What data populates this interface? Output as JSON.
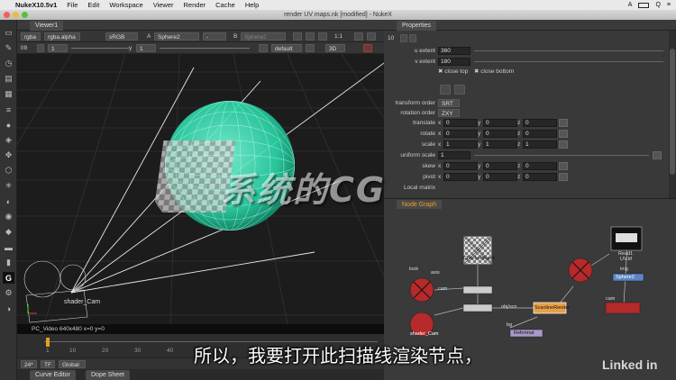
{
  "menubar": {
    "app": "NukeX10.5v1",
    "items": [
      "File",
      "Edit",
      "Workspace",
      "Viewer",
      "Render",
      "Cache",
      "Help"
    ],
    "right": [
      "A",
      "Q"
    ]
  },
  "window_title": "render UV maps.nk [modified] - NukeX",
  "viewer": {
    "tab": "Viewer1",
    "bar1": {
      "channels": "rgba",
      "alpha": "rgba.alpha",
      "colorspace": "sRGB",
      "a_label": "A",
      "a_input": "Sphere2",
      "dash": "-",
      "b_label": "B",
      "b_input": "Sphere2",
      "zoom": "1:1"
    },
    "bar2": {
      "fstop": "f/8",
      "gain": "1",
      "y_label": "y",
      "gamma": "1",
      "camera": "default",
      "mode": "3D"
    },
    "camera_label": "shader_Cam",
    "status": "PC_Video 640x480  x=0 y=0"
  },
  "timebar": {
    "fps": "24*",
    "tf": "TF",
    "global": "Global",
    "ticks": [
      "1",
      "10",
      "20",
      "30",
      "40"
    ]
  },
  "bottom_tabs": [
    "Curve Editor",
    "Dope Sheet"
  ],
  "properties": {
    "title": "Properties",
    "count": "10",
    "rows": [
      {
        "name": "u extent",
        "values": [
          "360"
        ]
      },
      {
        "name": "v extent",
        "values": [
          "180"
        ]
      },
      {
        "name": "transform order",
        "values": [
          "SRT"
        ]
      },
      {
        "name": "rotation order",
        "values": [
          "ZXY"
        ]
      },
      {
        "name": "translate",
        "values": [
          "0",
          "0",
          "0"
        ]
      },
      {
        "name": "rotate",
        "values": [
          "0",
          "0",
          "0"
        ]
      },
      {
        "name": "scale",
        "values": [
          "1",
          "1",
          "1"
        ]
      },
      {
        "name": "uniform scale",
        "values": [
          "1"
        ]
      },
      {
        "name": "skew",
        "values": [
          "0",
          "0",
          "0"
        ]
      },
      {
        "name": "pivot",
        "values": [
          "0",
          "0",
          "0"
        ]
      },
      {
        "name": "Local matrix",
        "values": []
      }
    ],
    "close_top": "close top",
    "close_bottom": "close bottom",
    "axes": [
      "x",
      "y",
      "z"
    ]
  },
  "nodegraph": {
    "title": "Node Graph",
    "nodes": {
      "checkerboard": "Checkerboard",
      "read": "Read1",
      "read_sub": "UV.tif",
      "sphere": "Sphere2",
      "scanline": "ScanlineRender",
      "shader_cam": "shader_Cam",
      "reformat": "Reformat"
    },
    "labels": [
      "look",
      "axis",
      "cam",
      "img",
      "obj/scn",
      "bg",
      "cam"
    ]
  },
  "subtitle": "所以，我要打开此扫描线渲染节点，",
  "watermark": "系统的CG",
  "linkedin": "Linked in"
}
